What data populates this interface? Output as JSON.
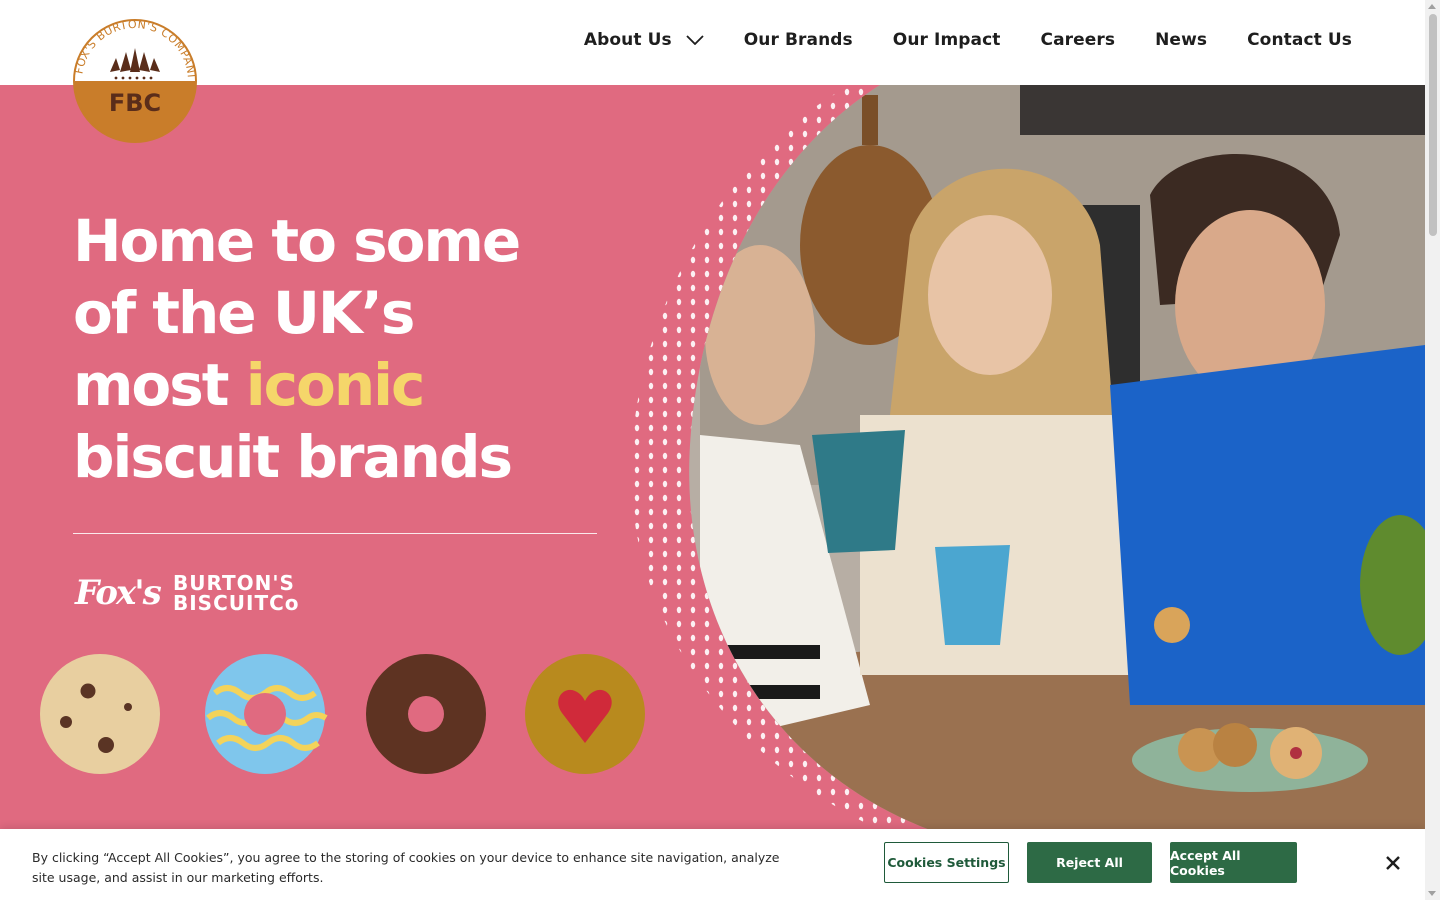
{
  "logo": {
    "arc_text": "FOX'S BURTON'S COMPANIES",
    "initials": "FBC"
  },
  "nav": {
    "items": [
      {
        "label": "About Us",
        "has_dropdown": true
      },
      {
        "label": "Our Brands"
      },
      {
        "label": "Our Impact"
      },
      {
        "label": "Careers"
      },
      {
        "label": "News"
      },
      {
        "label": "Contact Us"
      }
    ]
  },
  "hero": {
    "title_line1": "Home to some",
    "title_line2": "of the UK’s",
    "title_line3_a": "most ",
    "title_line3_highlight": "iconic",
    "title_line4": "biscuit brands",
    "brands": {
      "fox": "Fox's",
      "burtons_line1": "BURTON'S",
      "burtons_line2": "BISCUITCo"
    },
    "background_color": "#e06a80",
    "highlight_color": "#f5d66a"
  },
  "cookie_banner": {
    "text": "By clicking “Accept All Cookies”, you agree to the storing of cookies on your device to enhance site navigation, analyze site usage, and assist in our marketing efforts.",
    "settings_label": "Cookies Settings",
    "reject_label": "Reject All",
    "accept_label": "Accept All Cookies",
    "accent_color": "#2d6a45"
  }
}
